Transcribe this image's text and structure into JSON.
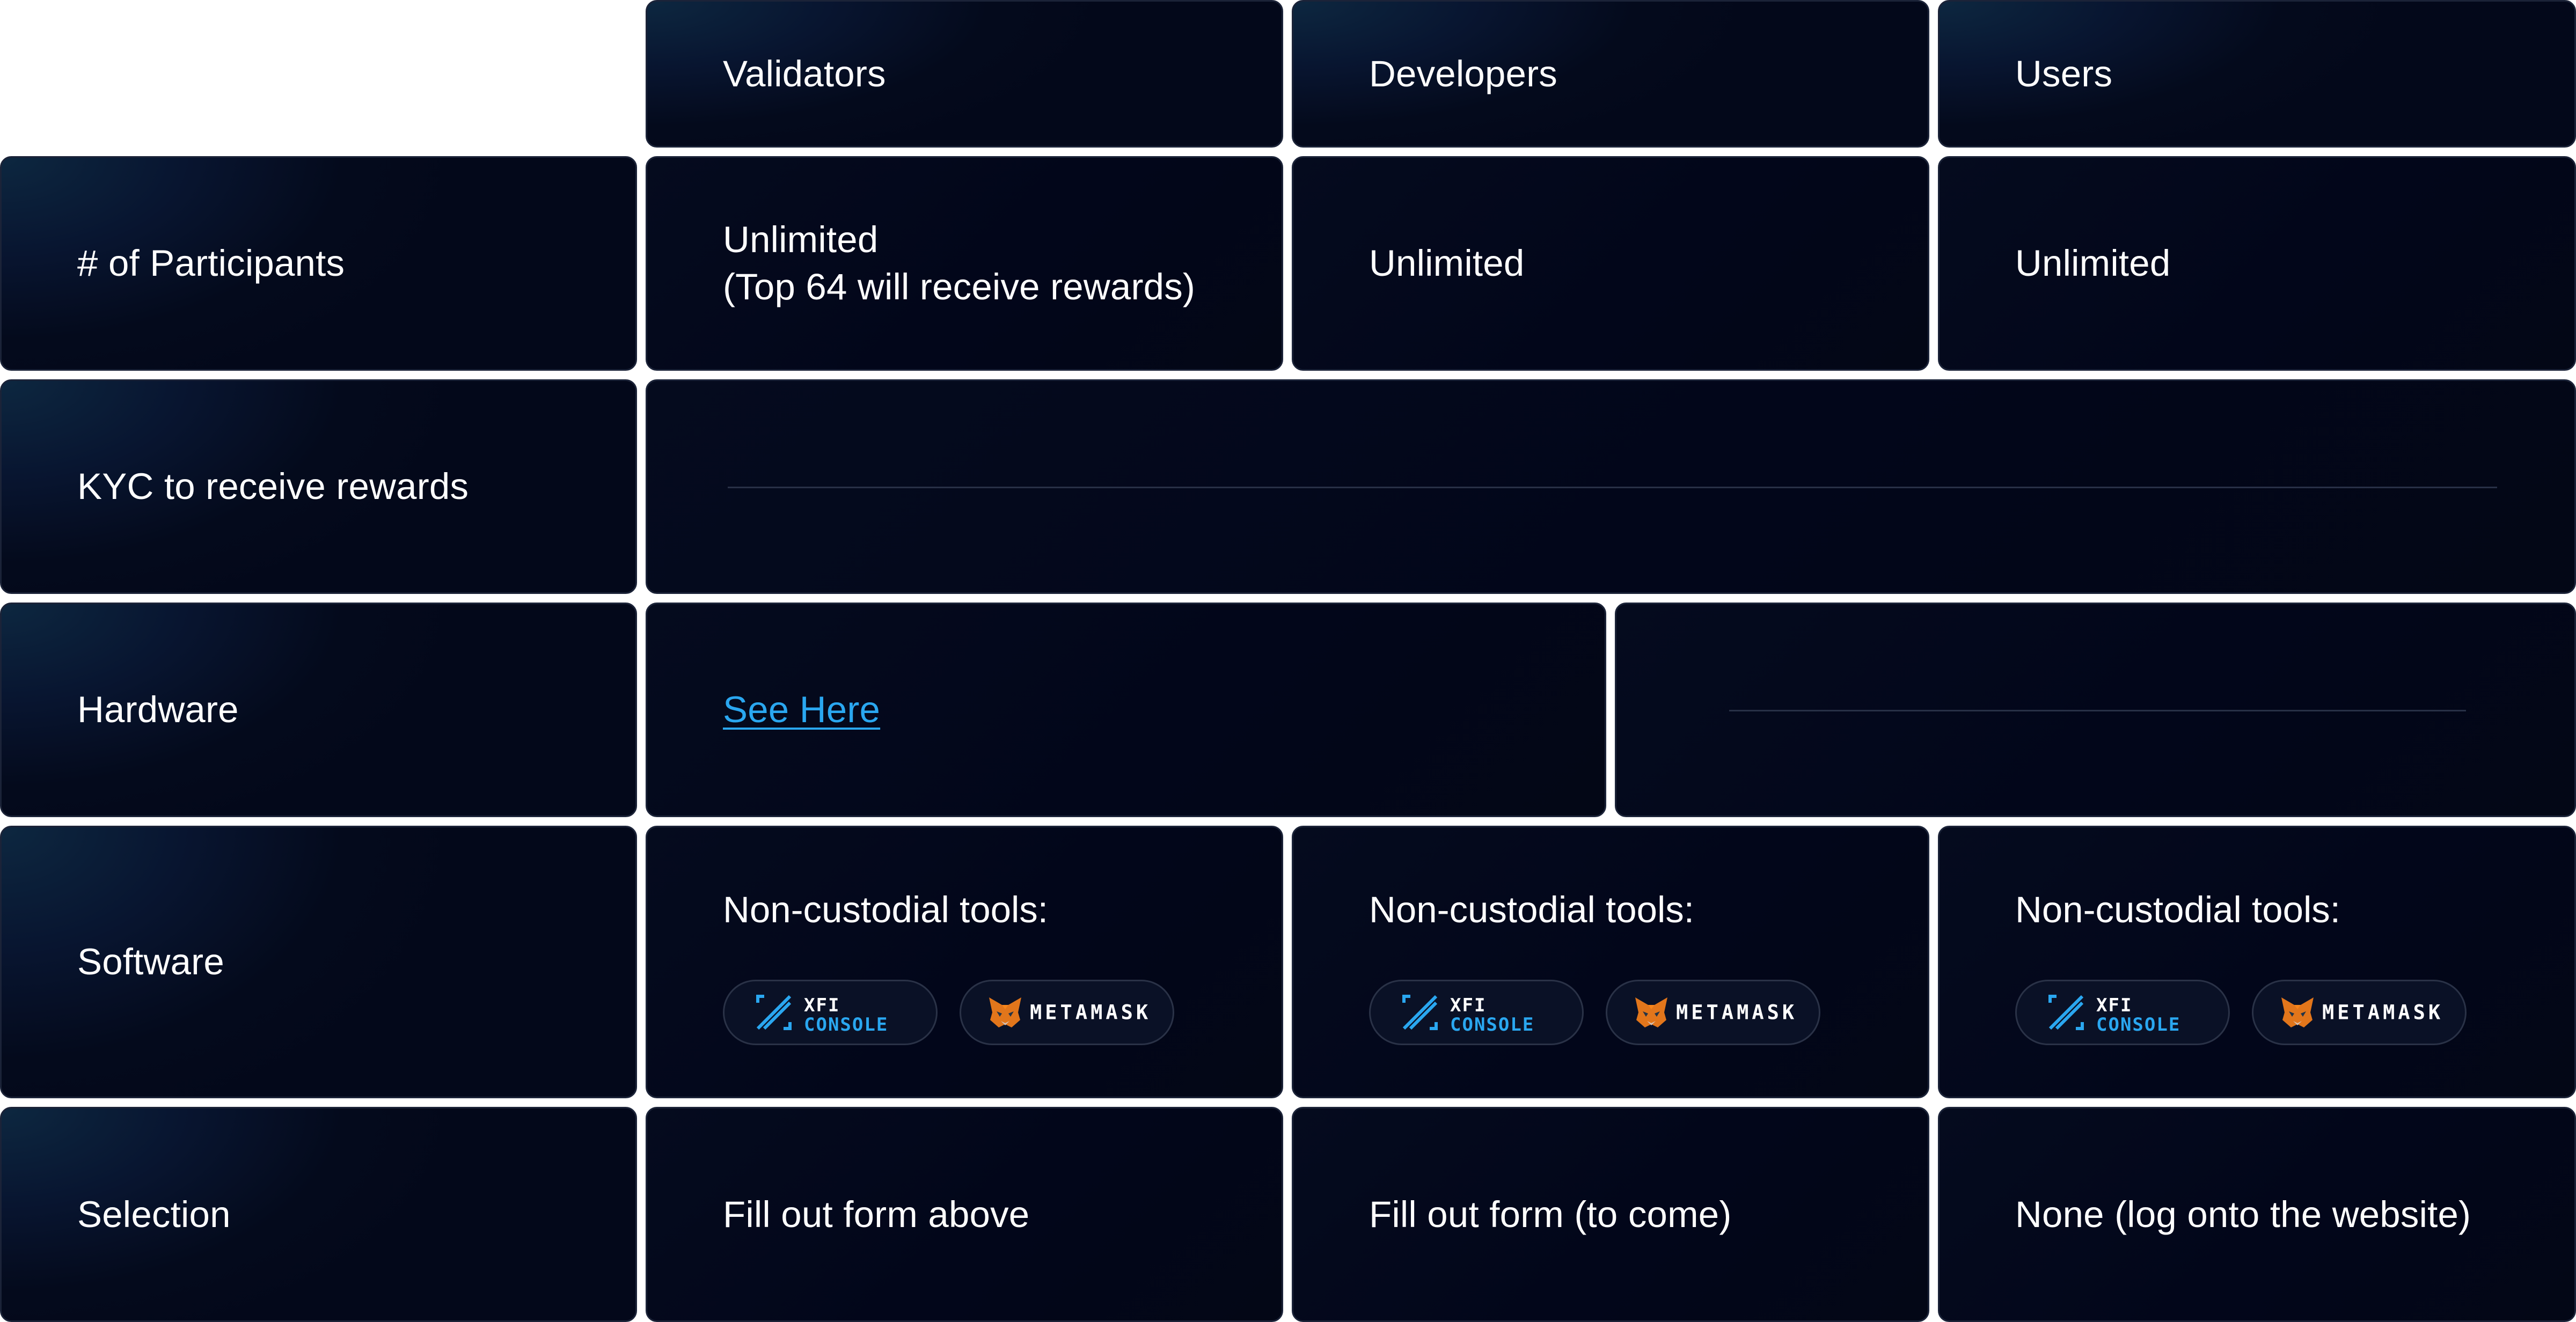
{
  "columns": [
    {
      "label": "Validators"
    },
    {
      "label": "Developers"
    },
    {
      "label": "Users"
    }
  ],
  "rows": {
    "participants": {
      "label": "# of Participants",
      "validators_line1": "Unlimited",
      "validators_line2": "(Top 64 will receive rewards)",
      "developers": "Unlimited",
      "users": "Unlimited"
    },
    "kyc": {
      "label": "KYC to receive rewards"
    },
    "hardware": {
      "label": "Hardware",
      "validators_link": "See Here"
    },
    "software": {
      "label": "Software",
      "tools_title": "Non-custodial tools:",
      "xfi_word1": "XFI",
      "xfi_word2": "CONSOLE",
      "metamask_word": "METAMASK"
    },
    "selection": {
      "label": "Selection",
      "validators": "Fill out form above",
      "developers": "Fill out form (to come)",
      "users": "None (log onto the website)"
    }
  },
  "colors": {
    "cell_background": "#03081a",
    "header_glow": "#0d2740",
    "border": "#1b2338",
    "text": "#ffffff",
    "link": "#2aa7f0",
    "xfi_accent": "#2aa7f0",
    "metamask_orange": "#e2761b"
  },
  "icons": {
    "xfi": "xfi-console-logo-icon",
    "metamask": "metamask-fox-icon"
  }
}
